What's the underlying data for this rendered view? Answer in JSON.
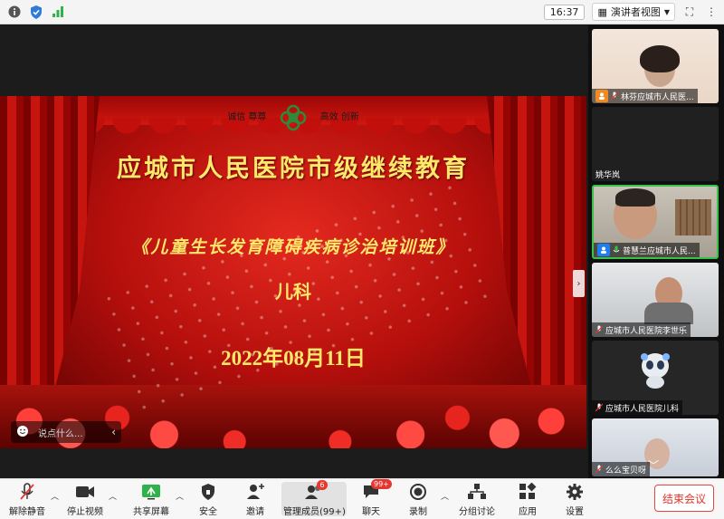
{
  "topbar": {
    "clock": "16:37",
    "view_mode": "演讲者视图",
    "colors": {
      "shield": "#2f7bd8",
      "signal": "#2fb24a"
    }
  },
  "slide": {
    "motto_left": "诚信 尊尊",
    "motto_right": "高效 创新",
    "title": "应城市人民医院市级继续教育",
    "subtitle": "《儿童生长发育障碍疾病诊治培训班》",
    "department": "儿科",
    "date": "2022年08月11日"
  },
  "chat": {
    "placeholder": "说点什么..."
  },
  "gallery": {
    "participants": [
      {
        "label": "林芬应城市人民医...",
        "role": "host"
      },
      {
        "label": "姚华岚",
        "role": "none"
      },
      {
        "label": "普慧兰应城市人民...",
        "role": "cohost"
      },
      {
        "label": "应城市人民医院李世乐",
        "role": "none"
      },
      {
        "label": "应城市人民医院儿科",
        "role": "none"
      },
      {
        "label": "么么宝贝呀",
        "role": "none"
      }
    ]
  },
  "toolbar": {
    "unmute": "解除静音",
    "stop_video": "停止视频",
    "share_screen": "共享屏幕",
    "security": "安全",
    "invite": "邀请",
    "members": "管理成员(99+)",
    "members_badge": "6",
    "chat": "聊天",
    "chat_badge": "99+",
    "record": "录制",
    "breakout": "分组讨论",
    "apps": "应用",
    "settings": "设置",
    "end_meeting": "结束会议"
  }
}
